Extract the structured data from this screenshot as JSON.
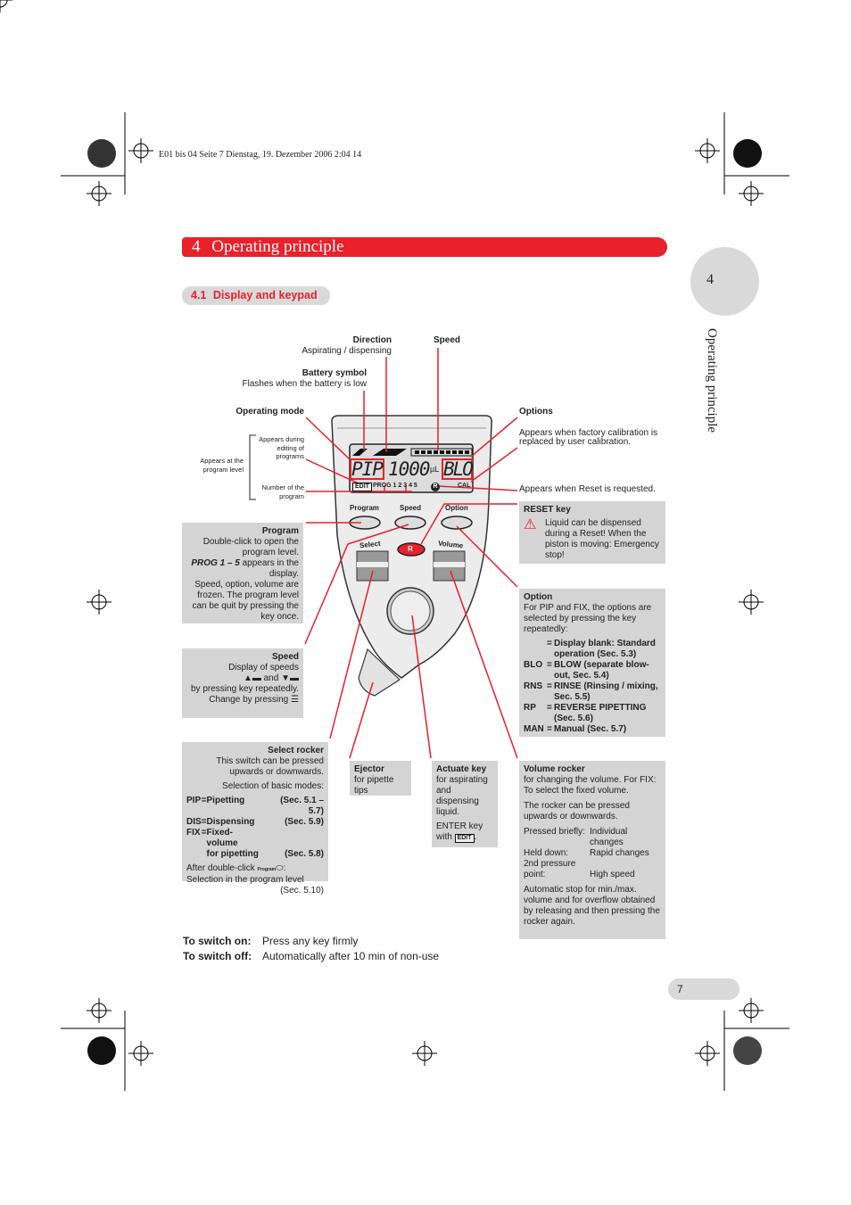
{
  "print_slug": "E01 bis 04  Seite 7  Dienstag, 19. Dezember 2006  2:04 14",
  "chapter": {
    "number": "4",
    "title": "Operating principle"
  },
  "section": {
    "number": "4.1",
    "title": "Display and keypad"
  },
  "side_tab": {
    "number": "4",
    "title": "Operating principle"
  },
  "callouts": {
    "direction": {
      "title": "Direction",
      "text": "Aspirating / dispensing"
    },
    "speed": {
      "title": "Speed"
    },
    "battery": {
      "title": "Battery symbol",
      "text": "Flashes when the battery is low"
    },
    "operating_mode": {
      "title": "Operating mode"
    },
    "appears_editing": "Appears during editing of programs",
    "appears_program_level": "Appears at the program level",
    "number_program": "Number of the program",
    "options": {
      "title": "Options",
      "text": "Appears when factory calibration is replaced by user calibration."
    },
    "reset_requested": "Appears when Reset is requested."
  },
  "display": {
    "mode": "PIP",
    "volume": "1000",
    "unit": "µL",
    "option": "BLO",
    "edit": "EDIT",
    "prog": "PROG 1 2 3 4 5",
    "reset": "R",
    "cal": "CAL"
  },
  "keys": {
    "program": "Program",
    "speed": "Speed",
    "option": "Option",
    "select": "Select",
    "volume": "Volume",
    "reset": "R"
  },
  "boxes": {
    "program": {
      "title": "Program",
      "l1": "Double-click to open the program level.",
      "l2_em": "PROG 1 – 5",
      "l2": " appears in the display.",
      "l3": "Speed, option, volume are frozen. The program level can be quit by pressing the key once."
    },
    "speed": {
      "title": "Speed",
      "l1": "Display of speeds",
      "and": "and",
      "l2": "by pressing key repeatedly.",
      "l3": "Change by pressing"
    },
    "select": {
      "title": "Select rocker",
      "l1": "This switch can be pressed upwards or downwards.",
      "l2": "Selection of basic modes:",
      "modes": [
        {
          "code": "PIP",
          "eq": "=",
          "name": "Pipetting",
          "sec": "(Sec. 5.1 – 5.7)"
        },
        {
          "code": "DIS",
          "eq": "=",
          "name": "Dispensing",
          "sec": "(Sec. 5.9)"
        },
        {
          "code": "FIX",
          "eq": "=",
          "name": "Fixed-volume",
          "sec": ""
        },
        {
          "code": "",
          "eq": "",
          "name": "for pipetting",
          "sec": "(Sec. 5.8)"
        }
      ],
      "l3": "After double-click",
      "l3b": ":",
      "program_small": "Program",
      "l4": "Selection in the program level",
      "l5": "(Sec. 5.10)"
    },
    "ejector": {
      "title": "Ejector",
      "text": "for pipette tips"
    },
    "actuate": {
      "title": "Actuate key",
      "text": "for aspirating and dispensing liquid.",
      "enter": "ENTER key with",
      "edit": "EDIT",
      "end": "."
    },
    "reset": {
      "title": "RESET key",
      "text": "Liquid can be dispensed during a Reset! When the piston is moving: Emergency stop!"
    },
    "option": {
      "title": "Option",
      "text": "For PIP and FIX, the options are selected by pressing the key repeatedly:",
      "items": [
        {
          "code": "",
          "eq": "=",
          "desc": "Display blank: Standard operation (Sec. 5.3)"
        },
        {
          "code": "BLO",
          "eq": "=",
          "desc": "BLOW (separate blow-out, Sec. 5.4)"
        },
        {
          "code": "RNS",
          "eq": "=",
          "desc": "RINSE (Rinsing / mixing, Sec. 5.5)"
        },
        {
          "code": "RP",
          "eq": "=",
          "desc": "REVERSE PIPETTING (Sec. 5.6)"
        },
        {
          "code": "MAN",
          "eq": "=",
          "desc": "Manual (Sec. 5.7)"
        }
      ]
    },
    "volume": {
      "title": "Volume rocker",
      "l1": "for changing the volume. For FIX: To select the fixed volume.",
      "l2": "The rocker can be pressed upwards or downwards.",
      "rows": [
        {
          "k": "Pressed briefly:",
          "v": "Individual changes"
        },
        {
          "k": "Held down:",
          "v": "Rapid changes"
        },
        {
          "k": "2nd pressure point:",
          "v": "High speed"
        }
      ],
      "l3": "Automatic stop for min./max. volume and for overflow obtained by releasing and then pressing the rocker again."
    }
  },
  "switch": {
    "on_label": "To switch on:",
    "on_text": "Press any key firmly",
    "off_label": "To switch off:",
    "off_text": "Automatically after 10 min of non-use"
  },
  "page_number": "7",
  "colors": {
    "accent": "#e8212b",
    "box": "#d4d4d4",
    "tab": "#d9d9d9"
  }
}
